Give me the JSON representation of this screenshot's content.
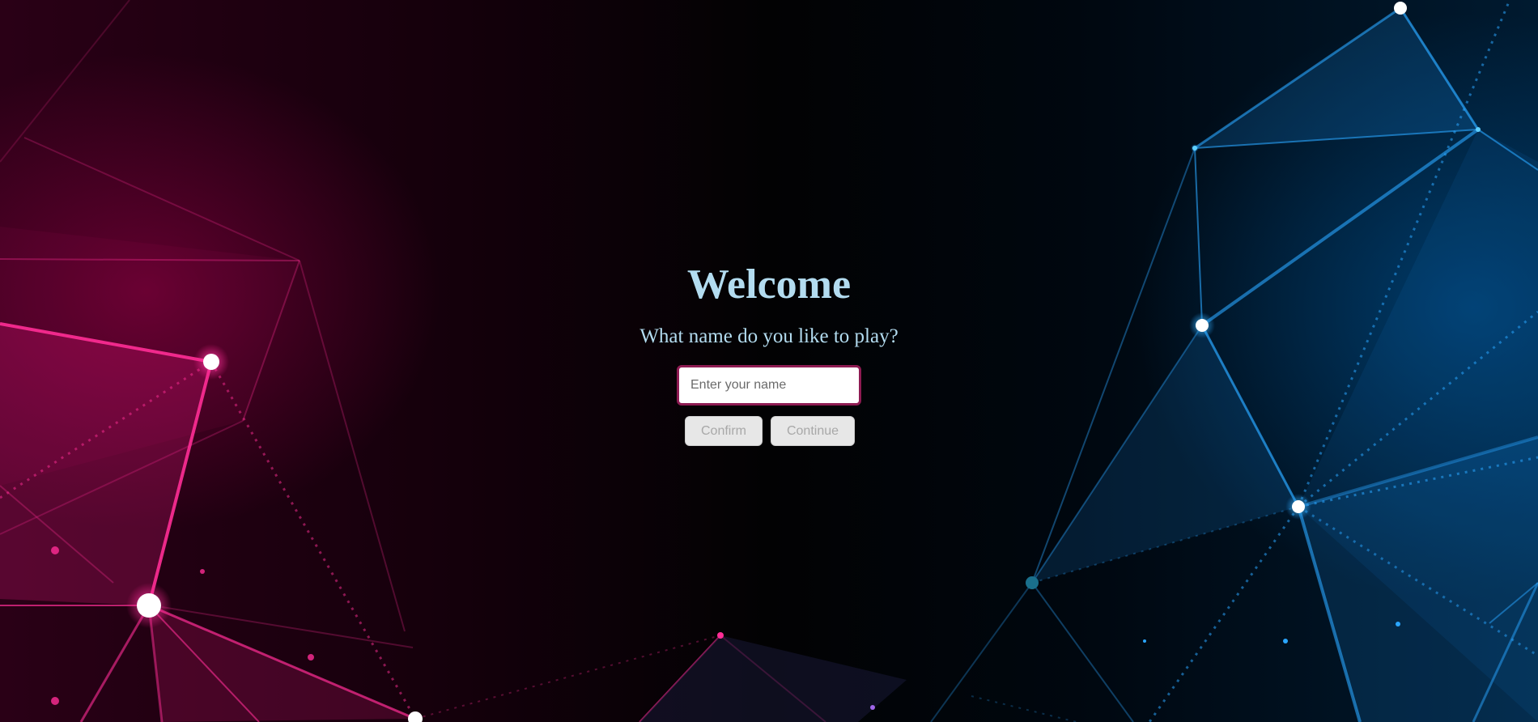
{
  "welcome": {
    "title": "Welcome",
    "prompt": "What name do you like to play?",
    "name_input": {
      "value": "",
      "placeholder": "Enter your name"
    },
    "confirm_label": "Confirm",
    "continue_label": "Continue"
  },
  "theme": {
    "title_color": "#b3dcf0",
    "input_border_color": "#8e1b52",
    "left_accent": "#ff1a8c",
    "right_accent": "#1a9cff",
    "button_bg": "#e7e7e7",
    "button_text": "#a8a8a8"
  }
}
